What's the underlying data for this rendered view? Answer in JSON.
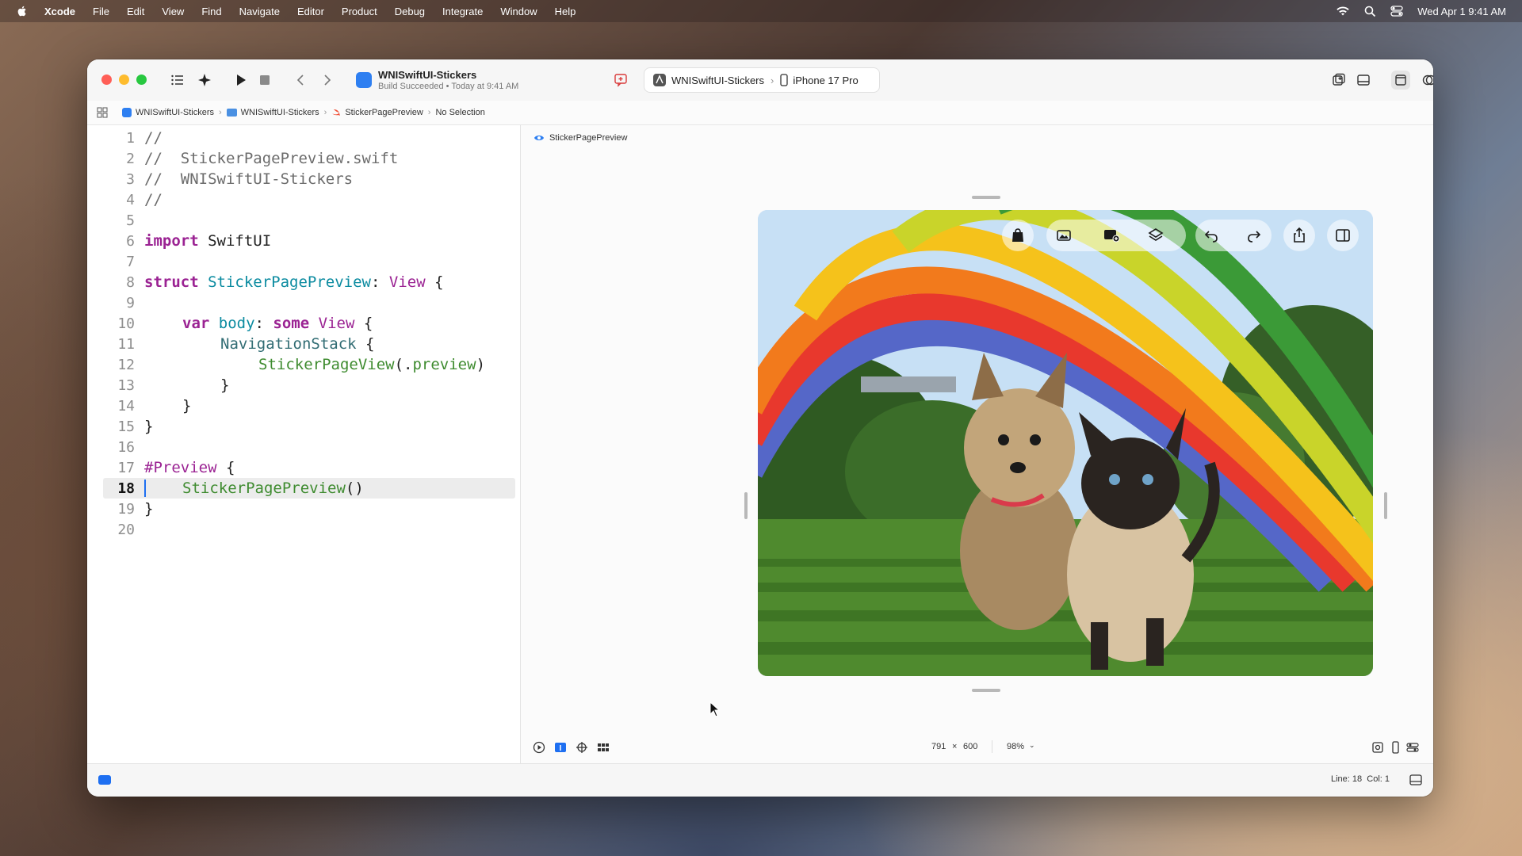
{
  "menubar": {
    "app": "Xcode",
    "items": [
      "File",
      "Edit",
      "View",
      "Find",
      "Navigate",
      "Editor",
      "Product",
      "Debug",
      "Integrate",
      "Window",
      "Help"
    ],
    "clock": "Wed Apr 1  9:41 AM"
  },
  "toolbar": {
    "project_title": "WNISwiftUI-Stickers",
    "build_status": "Build Succeeded • Today at 9:41 AM",
    "scheme": "WNISwiftUI-Stickers",
    "device": "iPhone 17 Pro"
  },
  "pathbar": {
    "items": [
      "WNISwiftUI-Stickers",
      "WNISwiftUI-Stickers",
      "StickerPagePreview",
      "No Selection"
    ]
  },
  "editor": {
    "lines": [
      {
        "n": "1"
      },
      {
        "n": "2"
      },
      {
        "n": "3"
      },
      {
        "n": "4"
      },
      {
        "n": "5"
      },
      {
        "n": "6"
      },
      {
        "n": "7"
      },
      {
        "n": "8"
      },
      {
        "n": "9"
      },
      {
        "n": "10"
      },
      {
        "n": "11"
      },
      {
        "n": "12"
      },
      {
        "n": "13"
      },
      {
        "n": "14"
      },
      {
        "n": "15"
      },
      {
        "n": "16"
      },
      {
        "n": "17"
      },
      {
        "n": "18"
      },
      {
        "n": "19"
      },
      {
        "n": "20"
      }
    ],
    "tokens": {
      "l1": "//",
      "l2": "//  StickerPagePreview.swift",
      "l3": "//  WNISwiftUI-Stickers",
      "l4": "//",
      "l6_kw": "import",
      "l6_mod": " SwiftUI",
      "l8_kw": "struct",
      "l8_name": " StickerPagePreview",
      "l8_colon": ": ",
      "l8_type": "View",
      "l8_brace": " {",
      "l10_kw": "var",
      "l10_name": " body",
      "l10_colon": ": ",
      "l10_kw2": "some",
      "l10_type": " View",
      "l10_brace": " {",
      "l11_type": "NavigationStack",
      "l11_brace": " {",
      "l12_type": "StickerPageView",
      "l12_paren": "(.",
      "l12_member": "preview",
      "l12_close": ")",
      "l13": "}",
      "l14": "}",
      "l15": "}",
      "l17_macro": "#Preview",
      "l17_brace": " {",
      "l18_call": "StickerPagePreview",
      "l18_paren": "()",
      "l19": "}"
    }
  },
  "canvas": {
    "label": "StickerPagePreview",
    "size_w": "791",
    "size_x": "×",
    "size_h": "600",
    "zoom": "98%"
  },
  "status": {
    "position": "Line: 18  Col: 1"
  },
  "colors": {
    "accent": "#1e6ff1",
    "keyword": "#9b2393",
    "type": "#0b8ba0",
    "comment": "#6c6c6c"
  }
}
